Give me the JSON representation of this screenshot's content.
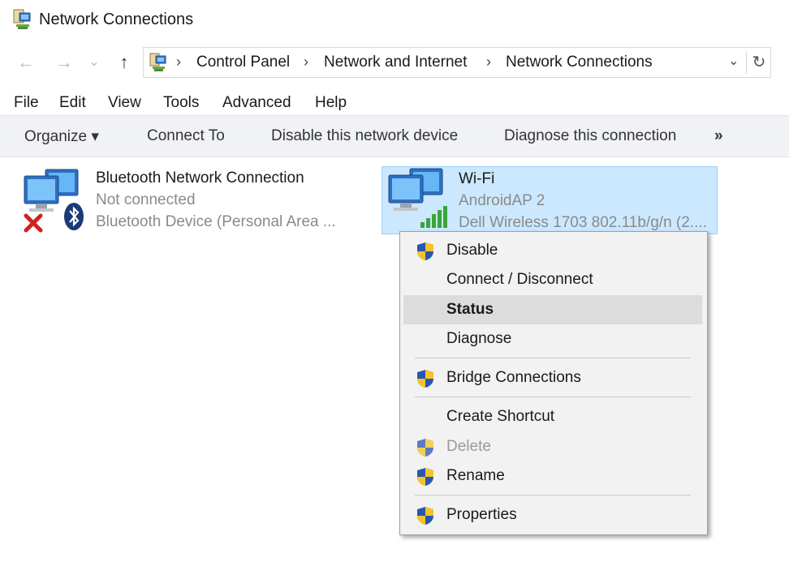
{
  "window": {
    "title": "Network Connections"
  },
  "nav": {
    "back_icon": "←",
    "forward_icon": "→",
    "recent_icon": "⌄",
    "up_icon": "↑"
  },
  "address": {
    "crumbs": [
      "Control Panel",
      "Network and Internet",
      "Network Connections"
    ],
    "separator": "›",
    "dropdown_icon": "⌄",
    "refresh_icon": "↻"
  },
  "menubar": [
    "File",
    "Edit",
    "View",
    "Tools",
    "Advanced",
    "Help"
  ],
  "commandbar": {
    "organize": "Organize ▾",
    "connect_to": "Connect To",
    "disable": "Disable this network device",
    "diagnose": "Diagnose this connection",
    "more": "»"
  },
  "connections": [
    {
      "name": "Bluetooth Network Connection",
      "status": "Not connected",
      "device": "Bluetooth Device (Personal Area ..."
    },
    {
      "name": "Wi-Fi",
      "status": "AndroidAP  2",
      "device": "Dell Wireless 1703 802.11b/g/n (2...."
    }
  ],
  "context_menu": {
    "items": [
      {
        "label": "Disable",
        "shield": true,
        "enabled": true,
        "bold": false,
        "highlighted": false
      },
      {
        "label": "Connect / Disconnect",
        "shield": false,
        "enabled": true,
        "bold": false,
        "highlighted": false
      },
      {
        "label": "Status",
        "shield": false,
        "enabled": true,
        "bold": true,
        "highlighted": true
      },
      {
        "label": "Diagnose",
        "shield": false,
        "enabled": true,
        "bold": false,
        "highlighted": false
      },
      {
        "label": "Bridge Connections",
        "shield": true,
        "enabled": true,
        "bold": false,
        "highlighted": false
      },
      {
        "label": "Create Shortcut",
        "shield": false,
        "enabled": true,
        "bold": false,
        "highlighted": false
      },
      {
        "label": "Delete",
        "shield": true,
        "enabled": false,
        "bold": false,
        "highlighted": false
      },
      {
        "label": "Rename",
        "shield": true,
        "enabled": true,
        "bold": false,
        "highlighted": false
      },
      {
        "label": "Properties",
        "shield": true,
        "enabled": true,
        "bold": false,
        "highlighted": false
      }
    ]
  },
  "colors": {
    "selection_bg": "#cce8ff",
    "selection_border": "#99d1ff",
    "commandbar_bg": "#f0f2f5",
    "menu_bg": "#f2f2f2"
  }
}
